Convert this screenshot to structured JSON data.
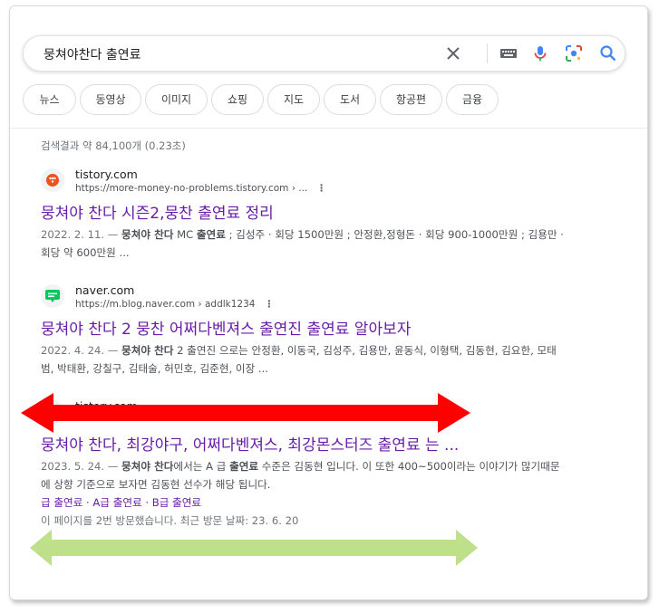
{
  "search": {
    "query": "뭉쳐야찬다 출연료"
  },
  "chips": [
    {
      "label": "뉴스"
    },
    {
      "label": "동영상"
    },
    {
      "label": "이미지"
    },
    {
      "label": "쇼핑"
    },
    {
      "label": "지도"
    },
    {
      "label": "도서"
    },
    {
      "label": "항공편"
    },
    {
      "label": "금융"
    }
  ],
  "stats": "검색결과 약 84,100개 (0.23초)",
  "results": [
    {
      "site": "tistory.com",
      "url": "https://more-money-no-problems.tistory.com › ...",
      "title": "뭉쳐야 찬다 시즌2,뭉찬 출연료 정리",
      "date": "2022. 2. 11. — ",
      "snippet_bold": "뭉쳐야 찬다",
      "snippet_mid": " MC ",
      "snippet_bold2": "출연료",
      "snippet_rest": " ; 김성주 · 회당 1500만원 ; 안정환,정형돈 · 회당 900-1000만원 ; 김용만 · 회당 약 600만원 ..."
    },
    {
      "site": "naver.com",
      "url": "https://m.blog.naver.com › addlk1234",
      "title": "뭉쳐야 찬다 2 뭉찬 어쩌다벤져스 출연진 출연료 알아보자",
      "date": "2022. 4. 24. — ",
      "snippet_bold": "뭉쳐야 찬다",
      "snippet_rest": " 2 출연진 으로는 안정환, 이동국, 김성주, 김용만, 윤동식, 이형택, 김동현, 김요한, 모태범, 박태환, 강칠구, 김태술, 허민호, 김준현, 이장 ..."
    },
    {
      "site": "tistory.com",
      "title": "뭉쳐야 찬다, 최강야구, 어쩌다벤져스, 최강몬스터즈 출연료 는 ...",
      "date": "2023. 5. 24. — ",
      "snippet_bold": "뭉쳐야 찬다",
      "snippet_mid": "에서는 A 급 ",
      "snippet_bold2": "출연료",
      "snippet_rest": " 수준은 김동현 입니다. 이 또한 400~500이라는 이야기가 많기때문에 상향 기준으로 보자면 김동현 선수가 해당 됩니다.",
      "sublinks": "급 출연료 · A급 출연료 · B급 출연료",
      "visited": "이 페이지를 2번 방문했습니다. 최근 방문 날짜: 23. 6. 20"
    }
  ],
  "colors": {
    "red_arrow": "#ff0000",
    "green_arrow": "#bfe08a",
    "visited_link": "#681da8"
  }
}
